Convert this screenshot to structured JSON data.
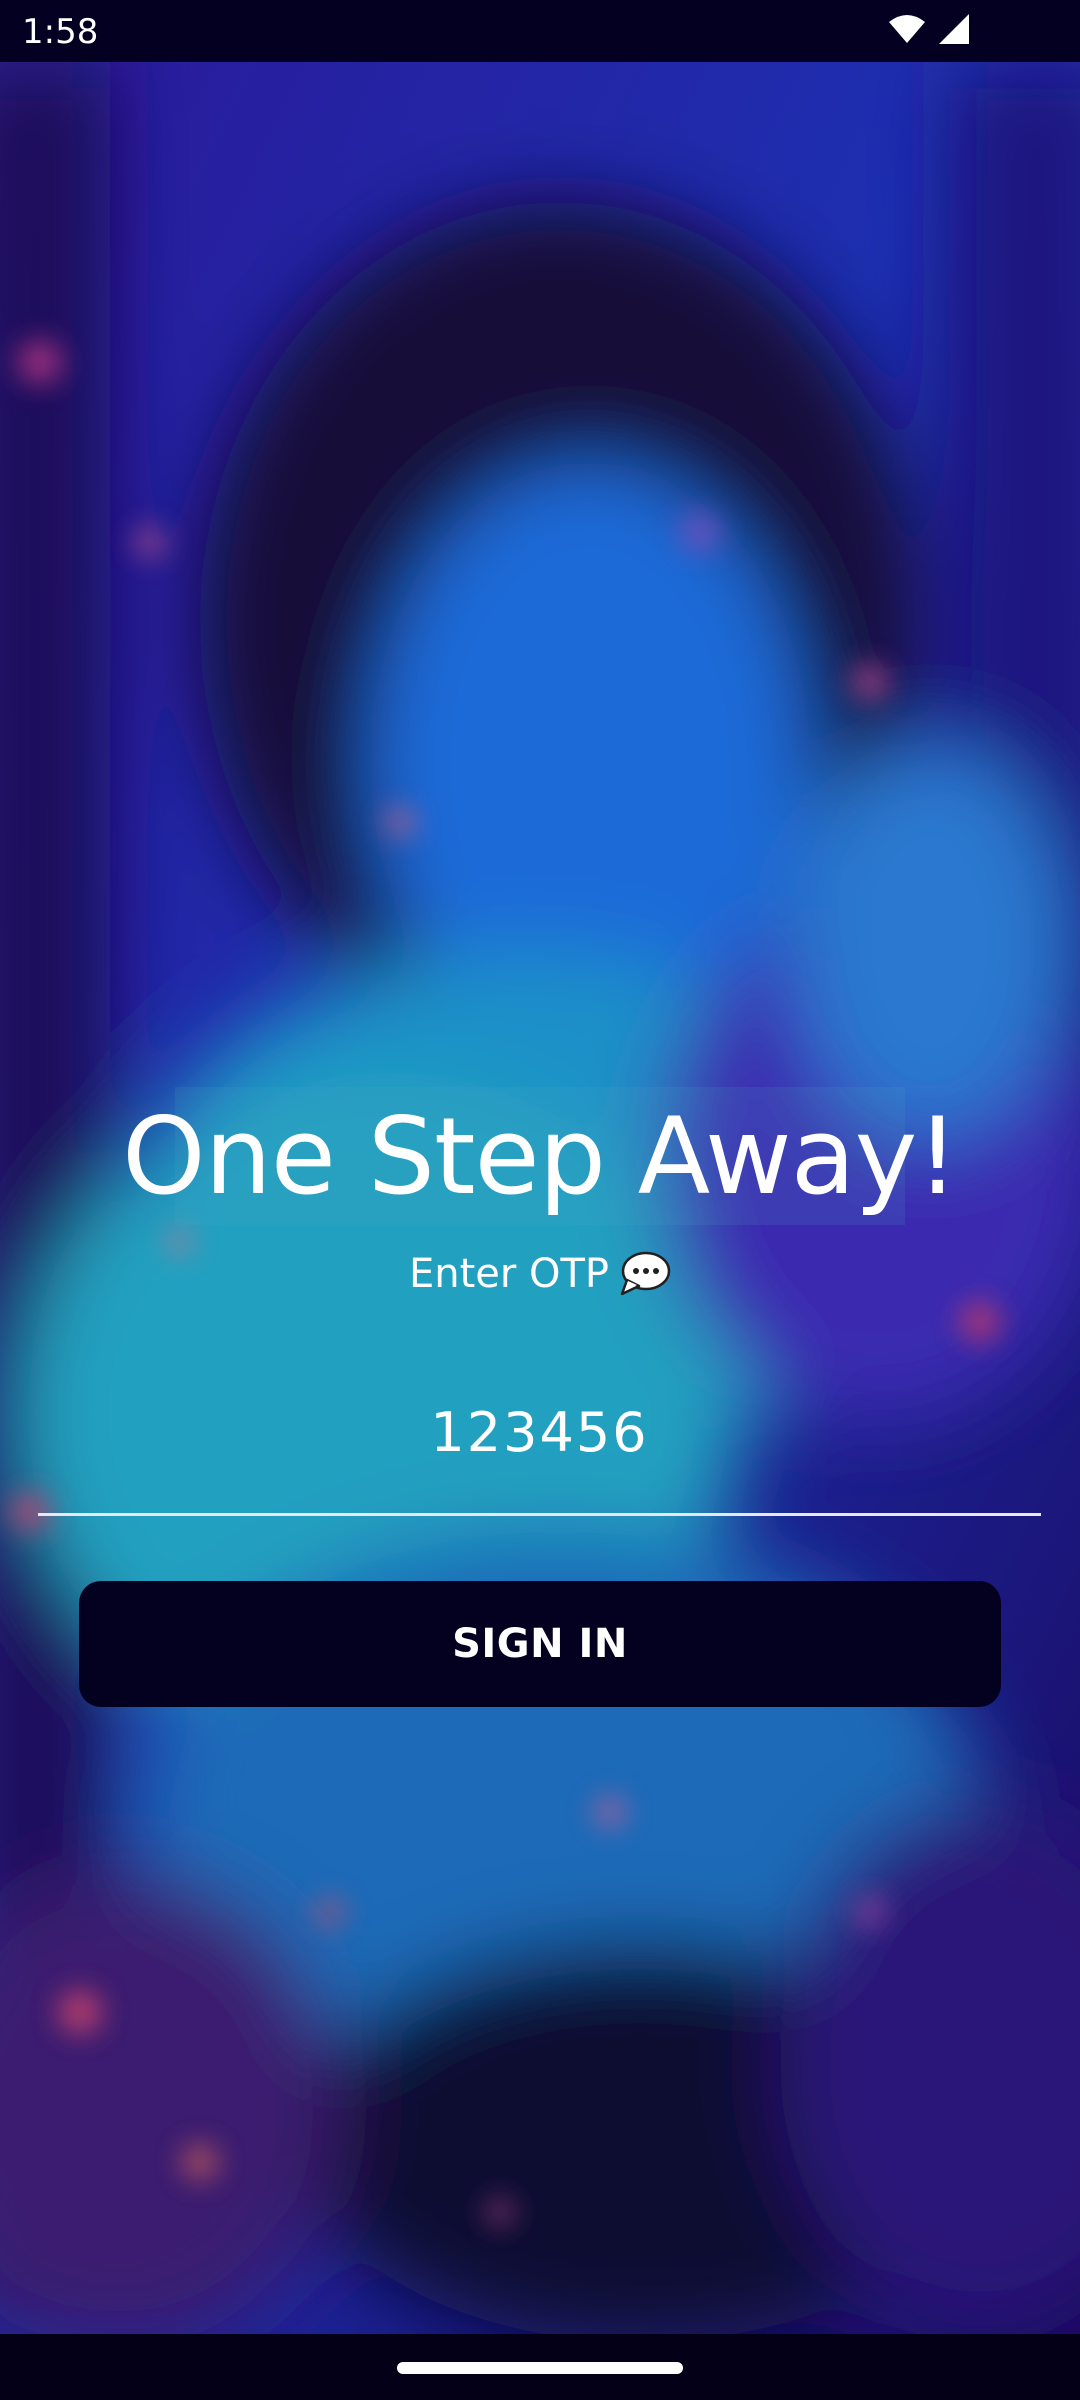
{
  "status_bar": {
    "time": "1:58",
    "icons": [
      "wifi-icon",
      "signal-icon"
    ]
  },
  "login": {
    "title": "One Step Away!",
    "subtitle": "Enter OTP",
    "subtitle_icon": "chat-bubble-icon",
    "otp_value": "123456",
    "sign_in_label": "SIGN IN"
  },
  "colors": {
    "status_bar_bg": "#030022",
    "button_bg": "#040020",
    "text": "#ffffff",
    "underline": "#e8e8f4"
  }
}
